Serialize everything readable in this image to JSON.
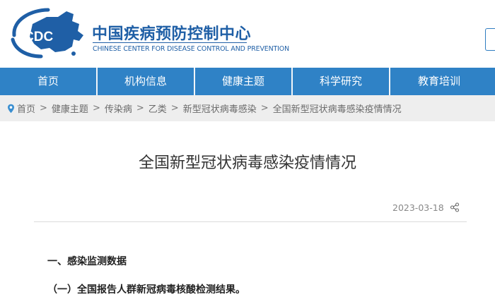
{
  "header": {
    "logo_text": "CDC",
    "org_name_cn": "中国疾病预防控制中心",
    "org_name_en": "CHINESE CENTER FOR DISEASE CONTROL AND PREVENTION"
  },
  "nav": {
    "items": [
      {
        "label": "首页"
      },
      {
        "label": "机构信息"
      },
      {
        "label": "健康主题"
      },
      {
        "label": "科学研究"
      },
      {
        "label": "教育培训"
      }
    ]
  },
  "breadcrumb": {
    "items": [
      {
        "label": "首页"
      },
      {
        "label": "健康主题"
      },
      {
        "label": "传染病"
      },
      {
        "label": "乙类"
      },
      {
        "label": "新型冠状病毒感染"
      },
      {
        "label": "全国新型冠状病毒感染疫情情况"
      }
    ],
    "separator": ">"
  },
  "article": {
    "title": "全国新型冠状病毒感染疫情情况",
    "date": "2023-03-18",
    "section_1": "一、感染监测数据",
    "subsection_1": "（一）全国报告人群新冠病毒核酸检测结果。"
  },
  "colors": {
    "brand_blue": "#1f5fa6",
    "nav_blue": "#2f82c6",
    "breadcrumb_bg": "#eeeeee"
  },
  "icons": {
    "breadcrumb": "location-pin-icon",
    "share": "share-icon"
  }
}
